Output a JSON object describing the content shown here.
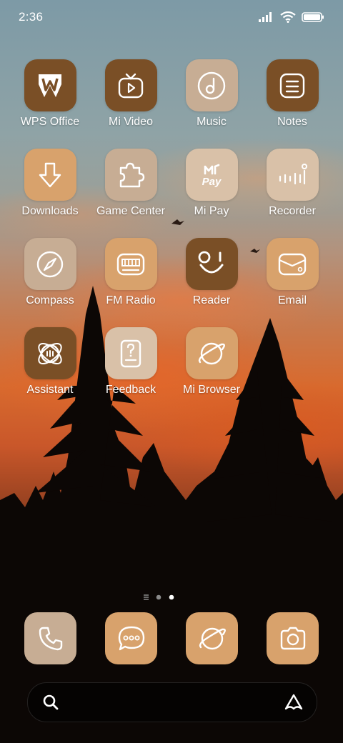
{
  "status_bar": {
    "time": "2:36"
  },
  "colors": {
    "dark_brown": "#7a4f26",
    "tan": "#d8a26c",
    "beige": "#c7ad94",
    "light_beige": "#d9c1a8"
  },
  "apps": [
    {
      "label": "WPS Office",
      "icon": "wps-office-icon"
    },
    {
      "label": "Mi Video",
      "icon": "tv-play-icon"
    },
    {
      "label": "Music",
      "icon": "music-note-icon"
    },
    {
      "label": "Notes",
      "icon": "notes-icon"
    },
    {
      "label": "Downloads",
      "icon": "download-arrow-icon"
    },
    {
      "label": "Game Center",
      "icon": "puzzle-icon"
    },
    {
      "label": "Mi Pay",
      "icon": "mi-pay-icon"
    },
    {
      "label": "Recorder",
      "icon": "waveform-icon"
    },
    {
      "label": "Compass",
      "icon": "compass-icon"
    },
    {
      "label": "FM Radio",
      "icon": "radio-icon"
    },
    {
      "label": "Reader",
      "icon": "reader-face-icon"
    },
    {
      "label": "Email",
      "icon": "envelope-icon"
    },
    {
      "label": "Assistant",
      "icon": "assistant-orbit-icon"
    },
    {
      "label": "Feedback",
      "icon": "feedback-question-icon"
    },
    {
      "label": "Mi Browser",
      "icon": "planet-icon"
    }
  ],
  "icon_text": {
    "pay": "Pay"
  },
  "page_indicator": {
    "pages": 2,
    "current": 2
  },
  "dock": [
    {
      "icon": "phone-icon"
    },
    {
      "icon": "chat-bubble-icon"
    },
    {
      "icon": "planet-icon"
    },
    {
      "icon": "camera-icon"
    }
  ],
  "search_bar": {
    "left_icon": "search-icon",
    "right_icon": "assistant-logo-icon"
  }
}
